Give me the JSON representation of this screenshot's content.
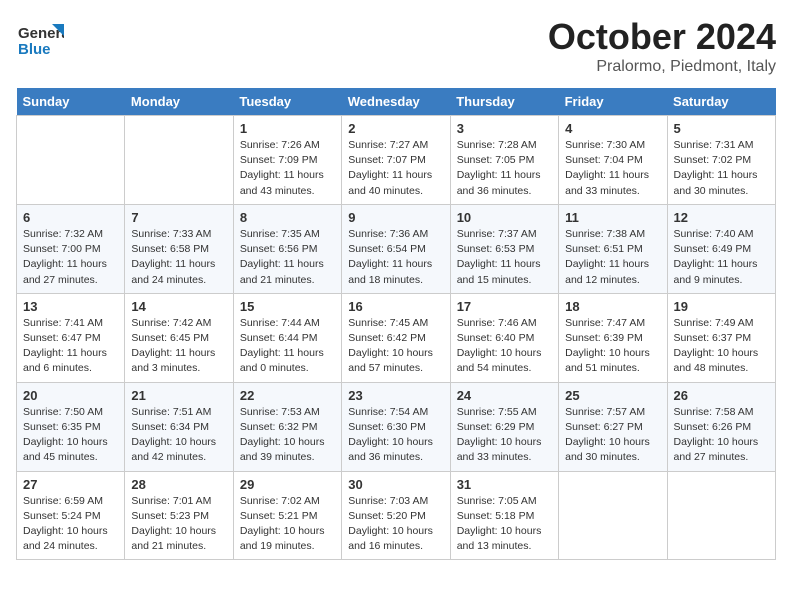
{
  "header": {
    "logo_line1": "General",
    "logo_line2": "Blue",
    "month": "October 2024",
    "location": "Pralormo, Piedmont, Italy"
  },
  "days_of_week": [
    "Sunday",
    "Monday",
    "Tuesday",
    "Wednesday",
    "Thursday",
    "Friday",
    "Saturday"
  ],
  "weeks": [
    [
      {
        "day": "",
        "info": ""
      },
      {
        "day": "",
        "info": ""
      },
      {
        "day": "1",
        "info": "Sunrise: 7:26 AM\nSunset: 7:09 PM\nDaylight: 11 hours and 43 minutes."
      },
      {
        "day": "2",
        "info": "Sunrise: 7:27 AM\nSunset: 7:07 PM\nDaylight: 11 hours and 40 minutes."
      },
      {
        "day": "3",
        "info": "Sunrise: 7:28 AM\nSunset: 7:05 PM\nDaylight: 11 hours and 36 minutes."
      },
      {
        "day": "4",
        "info": "Sunrise: 7:30 AM\nSunset: 7:04 PM\nDaylight: 11 hours and 33 minutes."
      },
      {
        "day": "5",
        "info": "Sunrise: 7:31 AM\nSunset: 7:02 PM\nDaylight: 11 hours and 30 minutes."
      }
    ],
    [
      {
        "day": "6",
        "info": "Sunrise: 7:32 AM\nSunset: 7:00 PM\nDaylight: 11 hours and 27 minutes."
      },
      {
        "day": "7",
        "info": "Sunrise: 7:33 AM\nSunset: 6:58 PM\nDaylight: 11 hours and 24 minutes."
      },
      {
        "day": "8",
        "info": "Sunrise: 7:35 AM\nSunset: 6:56 PM\nDaylight: 11 hours and 21 minutes."
      },
      {
        "day": "9",
        "info": "Sunrise: 7:36 AM\nSunset: 6:54 PM\nDaylight: 11 hours and 18 minutes."
      },
      {
        "day": "10",
        "info": "Sunrise: 7:37 AM\nSunset: 6:53 PM\nDaylight: 11 hours and 15 minutes."
      },
      {
        "day": "11",
        "info": "Sunrise: 7:38 AM\nSunset: 6:51 PM\nDaylight: 11 hours and 12 minutes."
      },
      {
        "day": "12",
        "info": "Sunrise: 7:40 AM\nSunset: 6:49 PM\nDaylight: 11 hours and 9 minutes."
      }
    ],
    [
      {
        "day": "13",
        "info": "Sunrise: 7:41 AM\nSunset: 6:47 PM\nDaylight: 11 hours and 6 minutes."
      },
      {
        "day": "14",
        "info": "Sunrise: 7:42 AM\nSunset: 6:45 PM\nDaylight: 11 hours and 3 minutes."
      },
      {
        "day": "15",
        "info": "Sunrise: 7:44 AM\nSunset: 6:44 PM\nDaylight: 11 hours and 0 minutes."
      },
      {
        "day": "16",
        "info": "Sunrise: 7:45 AM\nSunset: 6:42 PM\nDaylight: 10 hours and 57 minutes."
      },
      {
        "day": "17",
        "info": "Sunrise: 7:46 AM\nSunset: 6:40 PM\nDaylight: 10 hours and 54 minutes."
      },
      {
        "day": "18",
        "info": "Sunrise: 7:47 AM\nSunset: 6:39 PM\nDaylight: 10 hours and 51 minutes."
      },
      {
        "day": "19",
        "info": "Sunrise: 7:49 AM\nSunset: 6:37 PM\nDaylight: 10 hours and 48 minutes."
      }
    ],
    [
      {
        "day": "20",
        "info": "Sunrise: 7:50 AM\nSunset: 6:35 PM\nDaylight: 10 hours and 45 minutes."
      },
      {
        "day": "21",
        "info": "Sunrise: 7:51 AM\nSunset: 6:34 PM\nDaylight: 10 hours and 42 minutes."
      },
      {
        "day": "22",
        "info": "Sunrise: 7:53 AM\nSunset: 6:32 PM\nDaylight: 10 hours and 39 minutes."
      },
      {
        "day": "23",
        "info": "Sunrise: 7:54 AM\nSunset: 6:30 PM\nDaylight: 10 hours and 36 minutes."
      },
      {
        "day": "24",
        "info": "Sunrise: 7:55 AM\nSunset: 6:29 PM\nDaylight: 10 hours and 33 minutes."
      },
      {
        "day": "25",
        "info": "Sunrise: 7:57 AM\nSunset: 6:27 PM\nDaylight: 10 hours and 30 minutes."
      },
      {
        "day": "26",
        "info": "Sunrise: 7:58 AM\nSunset: 6:26 PM\nDaylight: 10 hours and 27 minutes."
      }
    ],
    [
      {
        "day": "27",
        "info": "Sunrise: 6:59 AM\nSunset: 5:24 PM\nDaylight: 10 hours and 24 minutes."
      },
      {
        "day": "28",
        "info": "Sunrise: 7:01 AM\nSunset: 5:23 PM\nDaylight: 10 hours and 21 minutes."
      },
      {
        "day": "29",
        "info": "Sunrise: 7:02 AM\nSunset: 5:21 PM\nDaylight: 10 hours and 19 minutes."
      },
      {
        "day": "30",
        "info": "Sunrise: 7:03 AM\nSunset: 5:20 PM\nDaylight: 10 hours and 16 minutes."
      },
      {
        "day": "31",
        "info": "Sunrise: 7:05 AM\nSunset: 5:18 PM\nDaylight: 10 hours and 13 minutes."
      },
      {
        "day": "",
        "info": ""
      },
      {
        "day": "",
        "info": ""
      }
    ]
  ]
}
